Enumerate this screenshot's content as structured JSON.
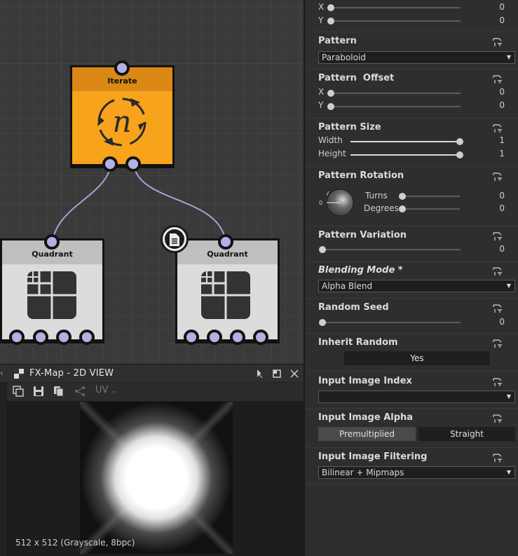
{
  "graph": {
    "nodes": [
      {
        "title": "Iterate"
      },
      {
        "title": "Quadrant"
      },
      {
        "title": "Quadrant"
      }
    ]
  },
  "view2d": {
    "title": "FX-Map - 2D VIEW",
    "toolbar": {
      "uv_label": "UV"
    },
    "image_info": "512 x 512 (Grayscale, 8bpc)"
  },
  "properties": {
    "offset_top": {
      "x_label": "X",
      "x_value": "0",
      "y_label": "Y",
      "y_value": "0"
    },
    "pattern": {
      "title": "Pattern",
      "value": "Paraboloid"
    },
    "pattern_offset": {
      "title": "Pattern  Offset",
      "x_label": "X",
      "x_value": "0",
      "y_label": "Y",
      "y_value": "0"
    },
    "pattern_size": {
      "title": "Pattern Size",
      "width_label": "Width",
      "width_value": "1",
      "height_label": "Height",
      "height_value": "1"
    },
    "pattern_rotation": {
      "title": "Pattern Rotation",
      "dial_zero": "0",
      "turns_label": "Turns",
      "turns_value": "0",
      "degrees_label": "Degrees",
      "degrees_value": "0"
    },
    "pattern_variation": {
      "title": "Pattern Variation",
      "value": "0"
    },
    "blending_mode": {
      "title": "Blending Mode *",
      "value": "Alpha Blend"
    },
    "random_seed": {
      "title": "Random Seed",
      "value": "0"
    },
    "inherit_random": {
      "title": "Inherit Random",
      "value": "Yes"
    },
    "input_image_index": {
      "title": "Input Image Index",
      "value": ""
    },
    "input_image_alpha": {
      "title": "Input Image Alpha",
      "option_1": "Premultiplied",
      "option_2": "Straight",
      "selected": "Premultiplied"
    },
    "input_image_filtering": {
      "title": "Input Image Filtering",
      "value": "Bilinear + Mipmaps"
    }
  },
  "colors": {
    "iterate_node": "#f7a31c",
    "iterate_header": "#d98914",
    "pin": "#b3b1e3",
    "wire": "#a8a2d6"
  }
}
